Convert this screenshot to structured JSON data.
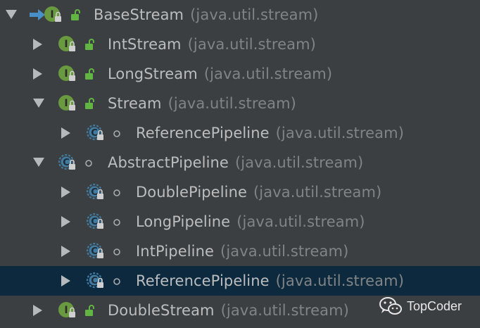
{
  "tree": {
    "nodes": [
      {
        "id": "n0",
        "name": "BaseStream",
        "pkg": "(java.util.stream)",
        "kind": "interface",
        "arrow": "expanded",
        "level": 0,
        "selected": false,
        "inherited": true
      },
      {
        "id": "n1",
        "name": "IntStream",
        "pkg": "(java.util.stream)",
        "kind": "interface",
        "arrow": "collapsed",
        "level": 1,
        "selected": false
      },
      {
        "id": "n2",
        "name": "LongStream",
        "pkg": "(java.util.stream)",
        "kind": "interface",
        "arrow": "collapsed",
        "level": 1,
        "selected": false
      },
      {
        "id": "n3",
        "name": "Stream",
        "pkg": "(java.util.stream)",
        "kind": "interface",
        "arrow": "expanded",
        "level": 1,
        "selected": false
      },
      {
        "id": "n4",
        "name": "ReferencePipeline",
        "pkg": "(java.util.stream)",
        "kind": "abstract-class",
        "arrow": "collapsed",
        "level": 2,
        "selected": false
      },
      {
        "id": "n5",
        "name": "AbstractPipeline",
        "pkg": "(java.util.stream)",
        "kind": "abstract-class",
        "arrow": "expanded",
        "level": 1,
        "selected": false
      },
      {
        "id": "n6",
        "name": "DoublePipeline",
        "pkg": "(java.util.stream)",
        "kind": "abstract-class",
        "arrow": "collapsed",
        "level": 2,
        "selected": false
      },
      {
        "id": "n7",
        "name": "LongPipeline",
        "pkg": "(java.util.stream)",
        "kind": "abstract-class",
        "arrow": "collapsed",
        "level": 2,
        "selected": false
      },
      {
        "id": "n8",
        "name": "IntPipeline",
        "pkg": "(java.util.stream)",
        "kind": "abstract-class",
        "arrow": "collapsed",
        "level": 2,
        "selected": false
      },
      {
        "id": "n9",
        "name": "ReferencePipeline",
        "pkg": "(java.util.stream)",
        "kind": "abstract-class",
        "arrow": "collapsed",
        "level": 2,
        "selected": true
      },
      {
        "id": "n10",
        "name": "DoubleStream",
        "pkg": "(java.util.stream)",
        "kind": "interface",
        "arrow": "collapsed",
        "level": 1,
        "selected": false
      }
    ]
  },
  "icons": {
    "interface_letter": "I",
    "class_letter": "C"
  },
  "watermark": {
    "text": "TopCoder",
    "icon": "wechat-icon"
  },
  "colors": {
    "background": "#3c3f41",
    "selection": "#0d293e",
    "text": "#bbbdbf",
    "package_text": "#818486",
    "interface_icon": "#6a9a3f",
    "class_icon": "#417ba0",
    "open_lock": "#62b543",
    "inherited_arrow": "#4a90c8"
  }
}
